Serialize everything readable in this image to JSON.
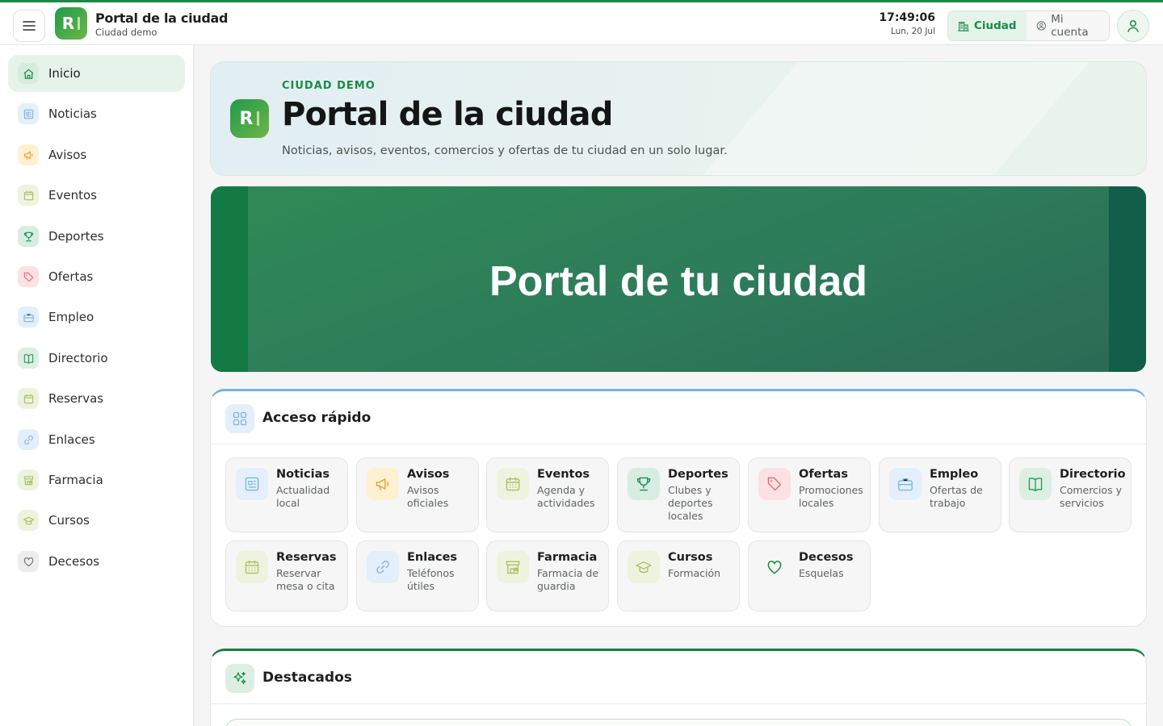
{
  "header": {
    "brand_mark": "R",
    "title": "Portal de la ciudad",
    "subtitle": "Ciudad demo",
    "time": "17:49:06",
    "date": "Lun, 20 Jul",
    "tabs": [
      {
        "label": "Ciudad",
        "active": true
      },
      {
        "label": "Mi cuenta",
        "active": false
      }
    ]
  },
  "sidebar": {
    "items": [
      {
        "label": "Inicio",
        "icon": "home-icon",
        "active": true
      },
      {
        "label": "Noticias",
        "icon": "newspaper-icon"
      },
      {
        "label": "Avisos",
        "icon": "megaphone-icon"
      },
      {
        "label": "Eventos",
        "icon": "calendar-icon"
      },
      {
        "label": "Deportes",
        "icon": "trophy-icon"
      },
      {
        "label": "Ofertas",
        "icon": "tag-icon"
      },
      {
        "label": "Empleo",
        "icon": "briefcase-icon"
      },
      {
        "label": "Directorio",
        "icon": "book-icon"
      },
      {
        "label": "Reservas",
        "icon": "calendar-icon"
      },
      {
        "label": "Enlaces",
        "icon": "link-icon"
      },
      {
        "label": "Farmacia",
        "icon": "store-icon"
      },
      {
        "label": "Cursos",
        "icon": "graduation-cap-icon"
      },
      {
        "label": "Decesos",
        "icon": "heart-icon"
      }
    ]
  },
  "hero": {
    "eyebrow": "CIUDAD DEMO",
    "title": "Portal de la ciudad",
    "description": "Noticias, avisos, eventos, comercios y ofertas de tu ciudad en un solo lugar."
  },
  "banner": {
    "text": "Portal de tu ciudad"
  },
  "quick_access": {
    "title": "Acceso rápido",
    "tiles": [
      {
        "title": "Noticias",
        "subtitle": "Actualidad local",
        "icon": "newspaper-icon"
      },
      {
        "title": "Avisos",
        "subtitle": "Avisos oficiales",
        "icon": "megaphone-icon"
      },
      {
        "title": "Eventos",
        "subtitle": "Agenda y actividades",
        "icon": "calendar-icon"
      },
      {
        "title": "Deportes",
        "subtitle": "Clubes y deportes locales",
        "icon": "trophy-icon"
      },
      {
        "title": "Ofertas",
        "subtitle": "Promociones locales",
        "icon": "tag-icon"
      },
      {
        "title": "Empleo",
        "subtitle": "Ofertas de trabajo",
        "icon": "briefcase-icon"
      },
      {
        "title": "Directorio",
        "subtitle": "Comercios y servicios",
        "icon": "book-icon"
      },
      {
        "title": "Reservas",
        "subtitle": "Reservar mesa o cita",
        "icon": "calendar-icon"
      },
      {
        "title": "Enlaces",
        "subtitle": "Teléfonos útiles",
        "icon": "link-icon"
      },
      {
        "title": "Farmacia",
        "subtitle": "Farmacia de guardia",
        "icon": "store-icon"
      },
      {
        "title": "Cursos",
        "subtitle": "Formación",
        "icon": "graduation-cap-icon"
      },
      {
        "title": "Decesos",
        "subtitle": "Esquelas",
        "icon": "heart-icon"
      }
    ]
  },
  "featured": {
    "title": "Destacados"
  },
  "colors": {
    "brand_green": "#1c8a45",
    "accent_blue": "#6fb3e2",
    "active_bg": "#e6f3ea"
  }
}
